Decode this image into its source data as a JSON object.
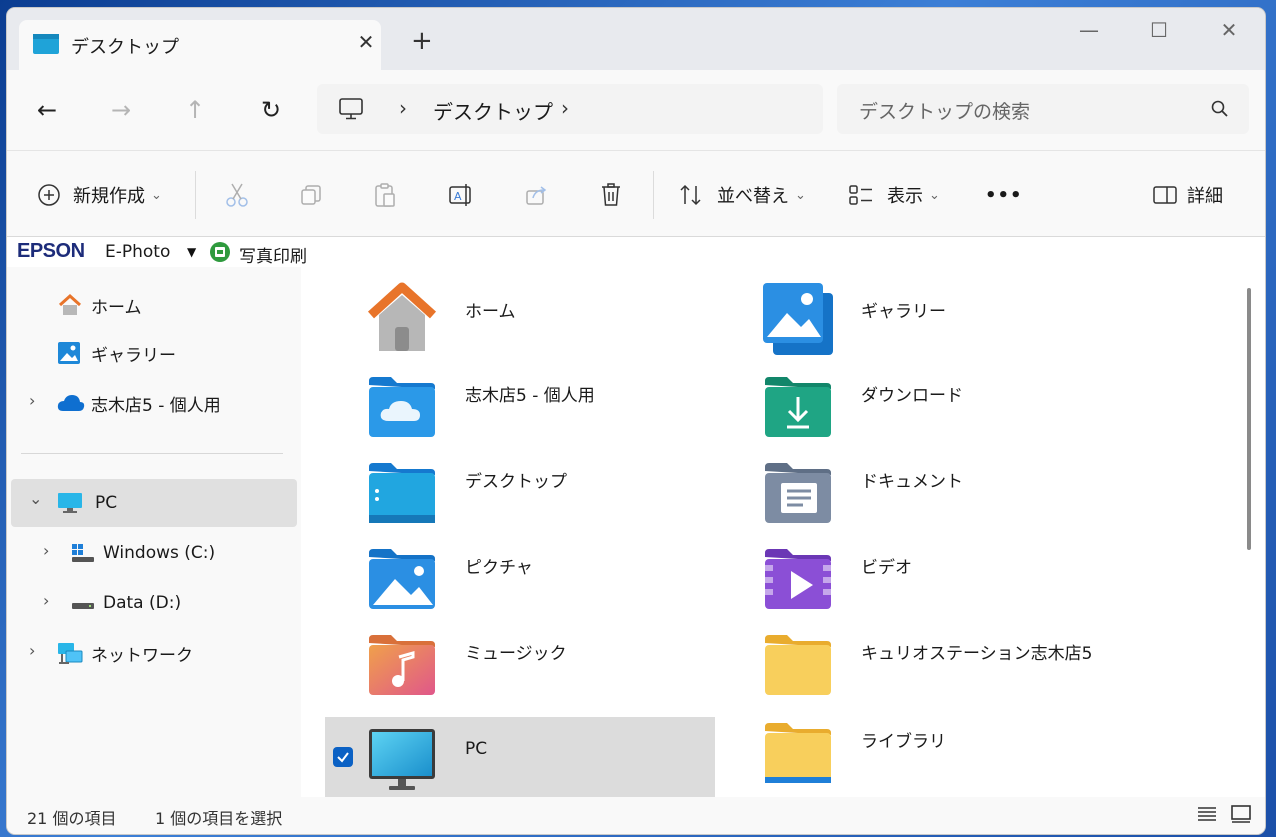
{
  "tab": {
    "title": "デスクトップ",
    "close": "✕",
    "new": "+"
  },
  "window_controls": {
    "minimize": "—",
    "maximize": "☐",
    "close": "✕"
  },
  "nav": {
    "back": "←",
    "forward": "→",
    "up": "↑",
    "refresh": "↻"
  },
  "address": {
    "sep1": "›",
    "crumb": "デスクトップ",
    "sep2": "›"
  },
  "search": {
    "placeholder": "デスクトップの検索"
  },
  "commandbar": {
    "new_label": "新規作成",
    "sort_label": "並べ替え",
    "view_label": "表示",
    "more_label": "•••",
    "details_label": "詳細",
    "chevron": "⌄"
  },
  "epson": {
    "logo": "EPSON",
    "ephoto": "E-Photo",
    "dropdown": "▼",
    "print": "写真印刷"
  },
  "sidebar": {
    "items": [
      {
        "label": "ホーム"
      },
      {
        "label": "ギャラリー"
      },
      {
        "label": "志木店5 - 個人用"
      },
      {
        "label": "PC"
      },
      {
        "label": "Windows (C:)"
      },
      {
        "label": "Data (D:)"
      },
      {
        "label": "ネットワーク"
      }
    ],
    "chev_right": "›",
    "chev_down": "⌄"
  },
  "content": {
    "items": [
      {
        "label": "ホーム",
        "icon": "home-icon"
      },
      {
        "label": "ギャラリー",
        "icon": "gallery-icon"
      },
      {
        "label": "志木店5 - 個人用",
        "icon": "onedrive-folder-icon"
      },
      {
        "label": "ダウンロード",
        "icon": "download-folder-icon"
      },
      {
        "label": "デスクトップ",
        "icon": "desktop-folder-icon"
      },
      {
        "label": "ドキュメント",
        "icon": "documents-folder-icon"
      },
      {
        "label": "ピクチャ",
        "icon": "pictures-folder-icon"
      },
      {
        "label": "ビデオ",
        "icon": "videos-folder-icon"
      },
      {
        "label": "ミュージック",
        "icon": "music-folder-icon"
      },
      {
        "label": "キュリオステーション志木店5",
        "icon": "folder-icon"
      },
      {
        "label": "PC",
        "icon": "pc-icon"
      },
      {
        "label": "ライブラリ",
        "icon": "library-folder-icon"
      }
    ]
  },
  "status": {
    "count": "21 個の項目",
    "selected": "1 個の項目を選択"
  },
  "colors": {
    "accent": "#0b61c4",
    "folder_yellow": "#f6c945",
    "selection": "#dcdcdc"
  }
}
